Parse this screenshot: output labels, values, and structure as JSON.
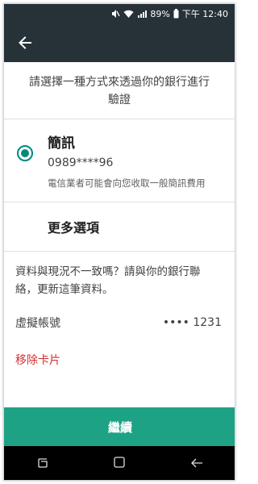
{
  "status_bar": {
    "battery": "89%",
    "time": "下午 12:40"
  },
  "intro_text": "請選擇一種方式來透過你的銀行進行驗證",
  "sms_option": {
    "title": "簡訊",
    "number": "0989****96",
    "note": "電信業者可能會向您收取一般簡訊費用"
  },
  "more_options": "更多選項",
  "notice": "資料與現況不一致嗎？請與你的銀行聯絡，更新這筆資料。",
  "account": {
    "label": "虛擬帳號",
    "value": "•••• 1231"
  },
  "remove_card": "移除卡片",
  "continue_button": "繼續",
  "colors": {
    "header": "#263238",
    "accent": "#1ea285",
    "radio": "#00897b",
    "danger": "#d32f2f"
  }
}
